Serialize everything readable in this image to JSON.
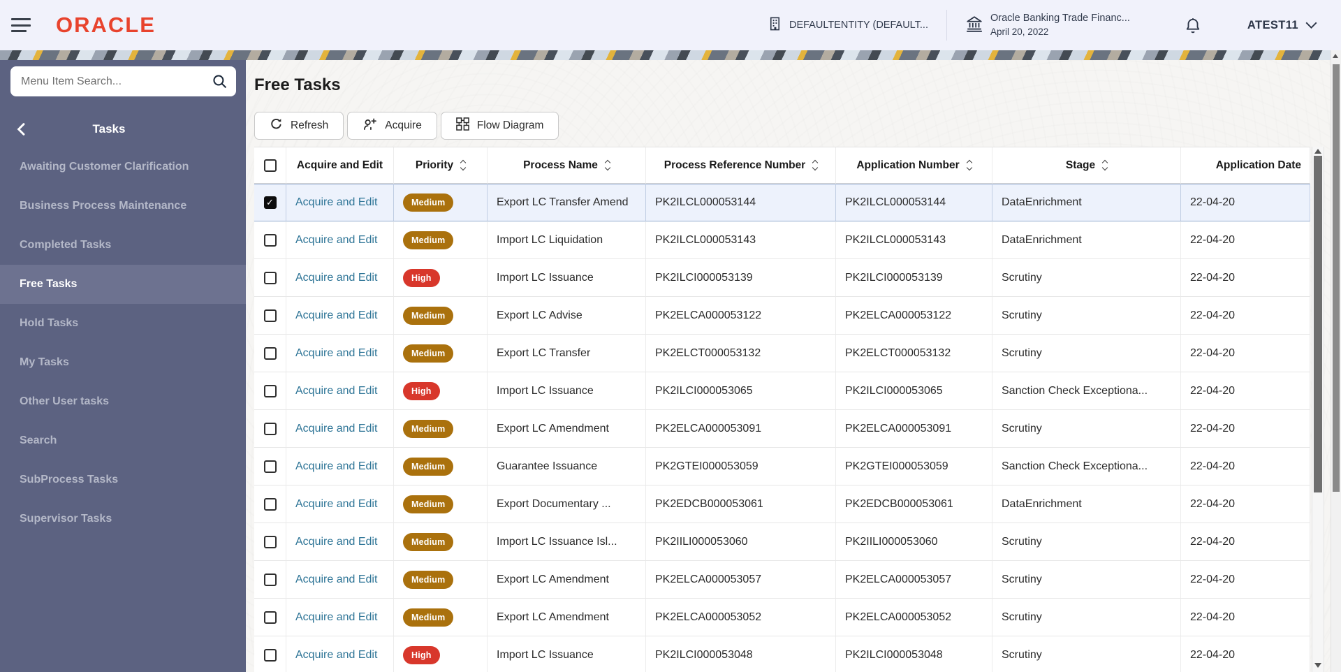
{
  "header": {
    "brand": "ORACLE",
    "entity_label": "DEFAULTENTITY (DEFAULT...",
    "app_name": "Oracle Banking Trade Financ...",
    "app_date": "April 20, 2022",
    "user_name": "ATEST11"
  },
  "sidebar": {
    "search_placeholder": "Menu Item Search...",
    "section_title": "Tasks",
    "items": [
      {
        "label": "Awaiting Customer Clarification",
        "selected": false
      },
      {
        "label": "Business Process Maintenance",
        "selected": false
      },
      {
        "label": "Completed Tasks",
        "selected": false
      },
      {
        "label": "Free Tasks",
        "selected": true
      },
      {
        "label": "Hold Tasks",
        "selected": false
      },
      {
        "label": "My Tasks",
        "selected": false
      },
      {
        "label": "Other User tasks",
        "selected": false
      },
      {
        "label": "Search",
        "selected": false
      },
      {
        "label": "SubProcess Tasks",
        "selected": false
      },
      {
        "label": "Supervisor Tasks",
        "selected": false
      }
    ]
  },
  "main": {
    "title": "Free Tasks",
    "toolbar": [
      {
        "label": "Refresh",
        "icon": "refresh-icon"
      },
      {
        "label": "Acquire",
        "icon": "acquire-person-plus-icon"
      },
      {
        "label": "Flow Diagram",
        "icon": "flow-diagram-icon"
      }
    ],
    "table": {
      "action_label": "Acquire and Edit",
      "columns": [
        {
          "label": "",
          "sortable": false
        },
        {
          "label": "Acquire and Edit",
          "sortable": false
        },
        {
          "label": "Priority",
          "sortable": true
        },
        {
          "label": "Process Name",
          "sortable": true
        },
        {
          "label": "Process Reference Number",
          "sortable": true
        },
        {
          "label": "Application Number",
          "sortable": true
        },
        {
          "label": "Stage",
          "sortable": true
        },
        {
          "label": "Application Date",
          "sortable": false
        }
      ],
      "rows": [
        {
          "checked": true,
          "selected": true,
          "priority": "Medium",
          "process_name": "Export LC Transfer Amend",
          "process_reference_number": "PK2ILCL000053144",
          "application_number": "PK2ILCL000053144",
          "stage": "DataEnrichment",
          "application_date": "22-04-20"
        },
        {
          "checked": false,
          "selected": false,
          "priority": "Medium",
          "process_name": "Import LC Liquidation",
          "process_reference_number": "PK2ILCL000053143",
          "application_number": "PK2ILCL000053143",
          "stage": "DataEnrichment",
          "application_date": "22-04-20"
        },
        {
          "checked": false,
          "selected": false,
          "priority": "High",
          "process_name": "Import LC Issuance",
          "process_reference_number": "PK2ILCI000053139",
          "application_number": "PK2ILCI000053139",
          "stage": "Scrutiny",
          "application_date": "22-04-20"
        },
        {
          "checked": false,
          "selected": false,
          "priority": "Medium",
          "process_name": "Export LC Advise",
          "process_reference_number": "PK2ELCA000053122",
          "application_number": "PK2ELCA000053122",
          "stage": "Scrutiny",
          "application_date": "22-04-20"
        },
        {
          "checked": false,
          "selected": false,
          "priority": "Medium",
          "process_name": "Export LC Transfer",
          "process_reference_number": "PK2ELCT000053132",
          "application_number": "PK2ELCT000053132",
          "stage": "Scrutiny",
          "application_date": "22-04-20"
        },
        {
          "checked": false,
          "selected": false,
          "priority": "High",
          "process_name": "Import LC Issuance",
          "process_reference_number": "PK2ILCI000053065",
          "application_number": "PK2ILCI000053065",
          "stage": "Sanction Check Exceptiona...",
          "application_date": "22-04-20"
        },
        {
          "checked": false,
          "selected": false,
          "priority": "Medium",
          "process_name": "Export LC Amendment",
          "process_reference_number": "PK2ELCA000053091",
          "application_number": "PK2ELCA000053091",
          "stage": "Scrutiny",
          "application_date": "22-04-20"
        },
        {
          "checked": false,
          "selected": false,
          "priority": "Medium",
          "process_name": "Guarantee Issuance",
          "process_reference_number": "PK2GTEI000053059",
          "application_number": "PK2GTEI000053059",
          "stage": "Sanction Check Exceptiona...",
          "application_date": "22-04-20"
        },
        {
          "checked": false,
          "selected": false,
          "priority": "Medium",
          "process_name": "Export Documentary ...",
          "process_reference_number": "PK2EDCB000053061",
          "application_number": "PK2EDCB000053061",
          "stage": "DataEnrichment",
          "application_date": "22-04-20"
        },
        {
          "checked": false,
          "selected": false,
          "priority": "Medium",
          "process_name": "Import LC Issuance Isl...",
          "process_reference_number": "PK2IILI000053060",
          "application_number": "PK2IILI000053060",
          "stage": "Scrutiny",
          "application_date": "22-04-20"
        },
        {
          "checked": false,
          "selected": false,
          "priority": "Medium",
          "process_name": "Export LC Amendment",
          "process_reference_number": "PK2ELCA000053057",
          "application_number": "PK2ELCA000053057",
          "stage": "Scrutiny",
          "application_date": "22-04-20"
        },
        {
          "checked": false,
          "selected": false,
          "priority": "Medium",
          "process_name": "Export LC Amendment",
          "process_reference_number": "PK2ELCA000053052",
          "application_number": "PK2ELCA000053052",
          "stage": "Scrutiny",
          "application_date": "22-04-20"
        },
        {
          "checked": false,
          "selected": false,
          "priority": "High",
          "process_name": "Import LC Issuance",
          "process_reference_number": "PK2ILCI000053048",
          "application_number": "PK2ILCI000053048",
          "stage": "Scrutiny",
          "application_date": "22-04-20"
        }
      ]
    }
  },
  "colors": {
    "brand_red": "#e8432d",
    "sidebar_bg": "#5c6281",
    "sidebar_selected_bg": "#6d7290",
    "link_blue": "#2d7496",
    "priority_medium_bg": "#aa710d",
    "priority_high_bg": "#d8372b",
    "selected_row_bg": "#edf2fc"
  }
}
